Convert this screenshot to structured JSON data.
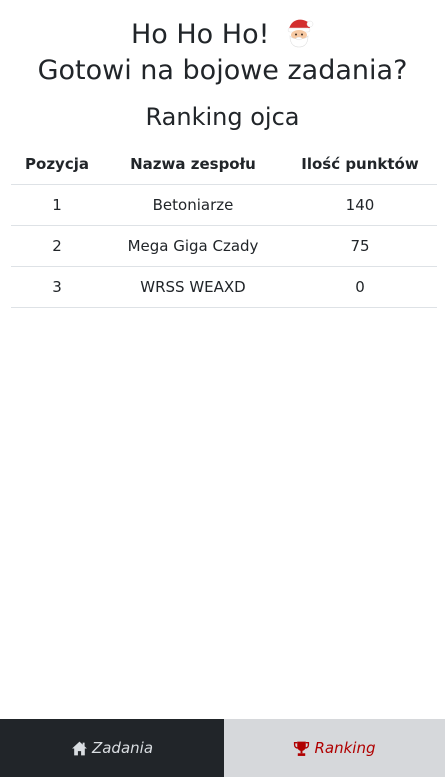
{
  "header": {
    "line1": "Ho Ho Ho!",
    "line2": "Gotowi na bojowe zadania?"
  },
  "ranking": {
    "title": "Ranking ojca",
    "columns": [
      "Pozycja",
      "Nazwa zespołu",
      "Ilość punktów"
    ],
    "rows": [
      {
        "position": "1",
        "team": "Betoniarze",
        "points": "140"
      },
      {
        "position": "2",
        "team": "Mega Giga Czady",
        "points": "75"
      },
      {
        "position": "3",
        "team": "WRSS WEAXD",
        "points": "0"
      }
    ]
  },
  "nav": {
    "tasks_label": "Zadania",
    "ranking_label": "Ranking",
    "tasks_icon": "home-icon",
    "ranking_icon": "trophy-icon",
    "active": "ranking"
  },
  "colors": {
    "nav_dark": "#212529",
    "nav_active_bg": "#d6d8db",
    "active_text": "#b00000",
    "santa_red": "#d32f2f"
  }
}
